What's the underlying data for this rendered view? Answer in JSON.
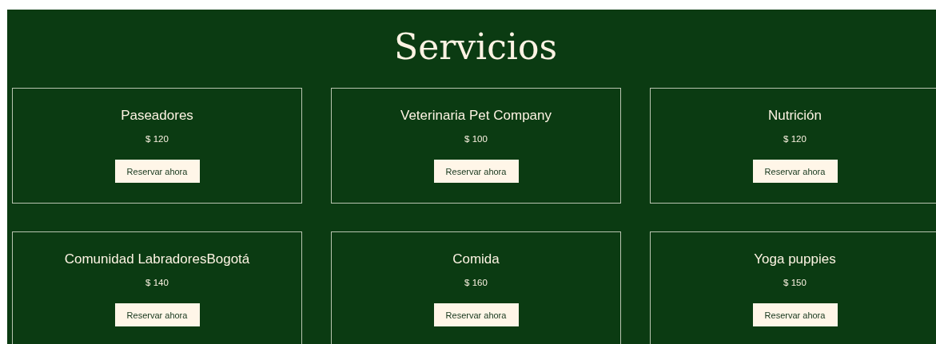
{
  "title": "Servicios",
  "services": [
    {
      "name": "Paseadores",
      "price": "$ 120",
      "button": "Reservar ahora"
    },
    {
      "name": "Veterinaria Pet Company",
      "price": "$ 100",
      "button": "Reservar ahora"
    },
    {
      "name": "Nutrición",
      "price": "$ 120",
      "button": "Reservar ahora"
    },
    {
      "name": "Comunidad LabradoresBogotá",
      "price": "$ 140",
      "button": "Reservar ahora"
    },
    {
      "name": "Comida",
      "price": "$ 160",
      "button": "Reservar ahora"
    },
    {
      "name": "Yoga puppies",
      "price": "$ 150",
      "button": "Reservar ahora"
    }
  ]
}
